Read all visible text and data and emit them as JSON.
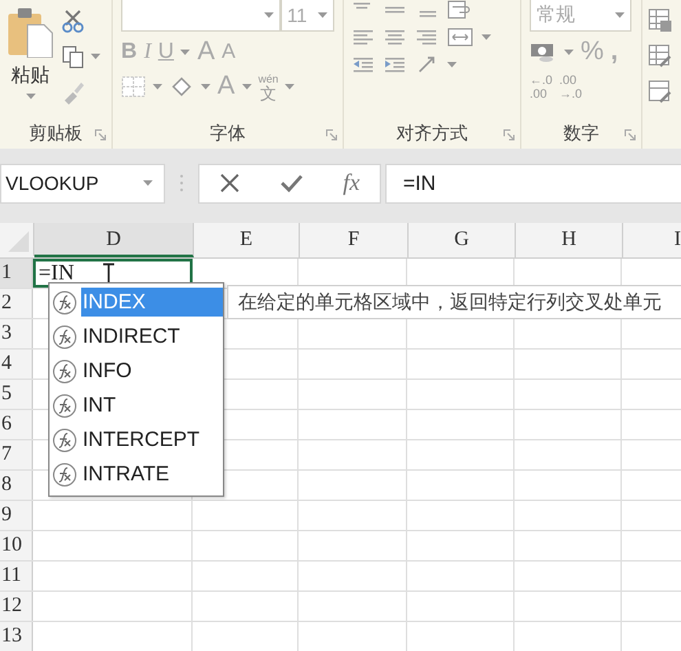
{
  "ribbon": {
    "groups": [
      {
        "kind": "clipboard",
        "label": "剪贴板",
        "paste_label": "粘贴"
      },
      {
        "kind": "font",
        "label": "字体",
        "font_size": "11",
        "bold": "B",
        "italic": "I",
        "underline": "U",
        "grow": "A",
        "shrink": "A",
        "font_color": "A",
        "phonetic_top": "wén",
        "phonetic_bottom": "文"
      },
      {
        "kind": "alignment",
        "label": "对齐方式"
      },
      {
        "kind": "number",
        "label": "数字",
        "format": "常规",
        "percent": "%",
        "comma": ",",
        "increase_decimal": [
          "←.0",
          ".00"
        ],
        "decrease_decimal": [
          ".00",
          "→.0"
        ]
      },
      {
        "kind": "styles"
      }
    ]
  },
  "formula_bar": {
    "name_box": "VLOOKUP",
    "function_button": "fx",
    "formula": "=IN"
  },
  "sheet": {
    "columns": [
      {
        "label": "D",
        "selected": true
      },
      {
        "label": "E",
        "selected": false
      },
      {
        "label": "F",
        "selected": false
      },
      {
        "label": "G",
        "selected": false
      },
      {
        "label": "H",
        "selected": false
      },
      {
        "label": "I",
        "selected": false
      }
    ],
    "rows": [
      {
        "label": "1",
        "selected": true
      },
      {
        "label": "2",
        "selected": false
      },
      {
        "label": "3",
        "selected": false
      },
      {
        "label": "4",
        "selected": false
      },
      {
        "label": "5",
        "selected": false
      },
      {
        "label": "6",
        "selected": false
      },
      {
        "label": "7",
        "selected": false
      },
      {
        "label": "8",
        "selected": false
      },
      {
        "label": "9",
        "selected": false
      },
      {
        "label": "10",
        "selected": false
      },
      {
        "label": "11",
        "selected": false
      },
      {
        "label": "12",
        "selected": false
      },
      {
        "label": "13",
        "selected": false
      }
    ],
    "active_cell": {
      "value": "=IN"
    }
  },
  "autocomplete": {
    "items": [
      {
        "label": "INDEX",
        "selected": true
      },
      {
        "label": "INDIRECT",
        "selected": false
      },
      {
        "label": "INFO",
        "selected": false
      },
      {
        "label": "INT",
        "selected": false
      },
      {
        "label": "INTERCEPT",
        "selected": false
      },
      {
        "label": "INTRATE",
        "selected": false
      }
    ],
    "tooltip": "在给定的单元格区域中，返回特定行列交叉处单元"
  }
}
